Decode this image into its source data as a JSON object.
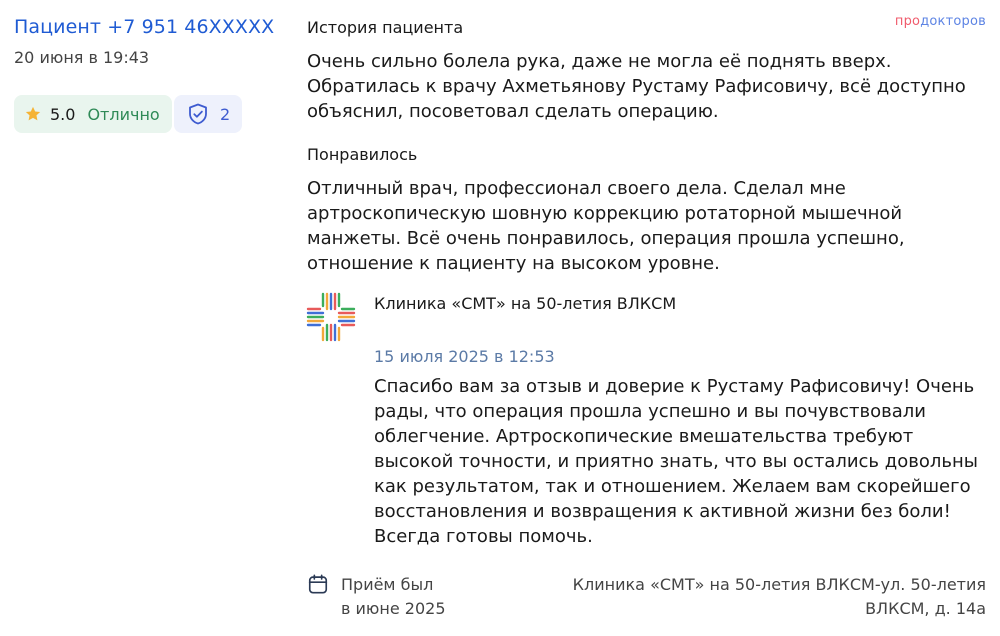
{
  "patient": {
    "name_link": "Пациент +7 951 46XXXXX",
    "date": "20 июня в 19:43"
  },
  "rating": {
    "value": "5.0",
    "word": "Отлично",
    "icon": "star-icon",
    "star_color": "#f5b335"
  },
  "verified": {
    "count": "2",
    "icon": "shield-check-icon"
  },
  "brand": {
    "part1": "про",
    "part2": "докторов"
  },
  "history": {
    "title": "История пациента",
    "text": "Очень сильно болела рука, даже не могла её поднять вверх. Обратилась к врачу Ахметьянову Рустаму Рафисовичу, всё доступно объяснил, посоветовал сделать операцию."
  },
  "liked": {
    "title": "Понравилось",
    "text": "Отличный врач, профессионал своего дела. Сделал мне артроскопическую шовную коррекцию ротаторной мышечной манжеты. Всё очень понравилось, операция прошла успешно, отношение к пациенту на высоком уровне."
  },
  "reply": {
    "clinic_name": "Клиника «СМТ» на 50-летия ВЛКСМ",
    "logo_icon": "clinic-cross-logo",
    "date": "15 июля 2025 в 12:53",
    "text": "Спасибо вам за отзыв и доверие к Рустаму Рафисовичу! Очень рады, что операция прошла успешно и вы почувствовали облегчение. Артроскопические вмешательства требуют высокой точности, и приятно знать, что вы остались довольны как результатом, так и отношением. Желаем вам скорейшего восстановления и возвращения к активной жизни без боли! Всегда готовы помочь."
  },
  "visit": {
    "icon": "calendar-icon",
    "line1": "Приём был",
    "line2": "в июне 2025",
    "address_line1": "Клиника «СМТ» на 50-летия ВЛКСМ-ул. 50-летия",
    "address_line2": "ВЛКСМ, д. 14а"
  },
  "colors": {
    "link": "#1f5bd3",
    "rating_bg": "#e9f5ee",
    "rating_word": "#2f8a57",
    "verified_bg": "#eef1fc",
    "reply_date": "#5b7aa6"
  }
}
